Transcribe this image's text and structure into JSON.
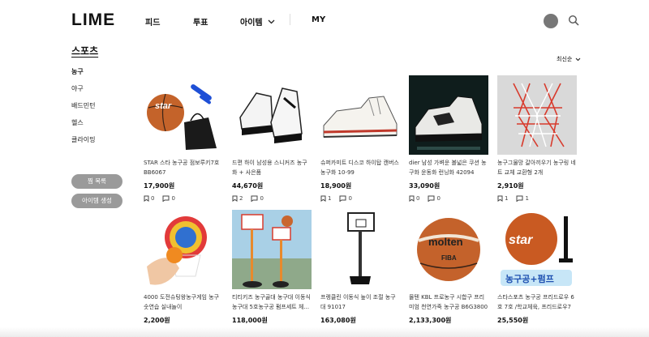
{
  "header": {
    "logo": "LIME",
    "nav": [
      "피드",
      "투표",
      "아이템",
      "MY"
    ]
  },
  "sidebar": {
    "title": "스포츠",
    "items": [
      "농구",
      "야구",
      "배드민턴",
      "헬스",
      "클라이밍"
    ],
    "active": 0,
    "buttons": [
      "찜 목록",
      "아이템 생성"
    ]
  },
  "sort_label": "최신순",
  "products": [
    {
      "title": "STAR 스타 농구공 점보루키7호 BB6067",
      "price": "17,900원",
      "bookmarks": "0",
      "comments": "0"
    },
    {
      "title": "드편 하이 남성용 스니커즈 농구화 + 사은품",
      "price": "44,670원",
      "bookmarks": "2",
      "comments": "0"
    },
    {
      "title": "슈퍼카미트 디스코 하이탑 캔버스 농구화 10-99",
      "price": "18,900원",
      "bookmarks": "1",
      "comments": "0"
    },
    {
      "title": "dier 남성 가벼운 볼넓은 쿠션 농구화 운동화 런닝화 42094",
      "price": "33,090원",
      "bookmarks": "0",
      "comments": "0"
    },
    {
      "title": "농구그물망 갈아끼우기 농구링 네트 교체 교환형 2개",
      "price": "2,910원",
      "bookmarks": "1",
      "comments": "1"
    },
    {
      "title": "4000 도전슈팅왕농구게임 농구 숫연습 실내놀이",
      "price": "2,200원",
      "bookmarks": "1",
      "comments": "0"
    },
    {
      "title": "티티키즈 농구골대 농구대 이동식 농구대 5호농구공 펌프세트 체...",
      "price": "118,000원",
      "bookmarks": "1",
      "comments": "0"
    },
    {
      "title": "프렝클린 이동식 높이 조절 농구대 91017",
      "price": "163,080원",
      "bookmarks": "1",
      "comments": "0"
    },
    {
      "title": "몰텐 KBL 프로농구 시합구 프리미엄 천연가죽 농구공 B6G3800",
      "price": "2,133,300원",
      "bookmarks": "1",
      "comments": "0"
    },
    {
      "title": "스타스포츠 농구공 프리드로우 6호 7호 /학교체육, 프리드로우7 ...",
      "price": "25,550원",
      "bookmarks": "1",
      "comments": "0"
    }
  ],
  "image_text": {
    "molten": "molten",
    "star": "star",
    "pump_banner": "농구공+펌프",
    "fiba": "FIBA"
  }
}
